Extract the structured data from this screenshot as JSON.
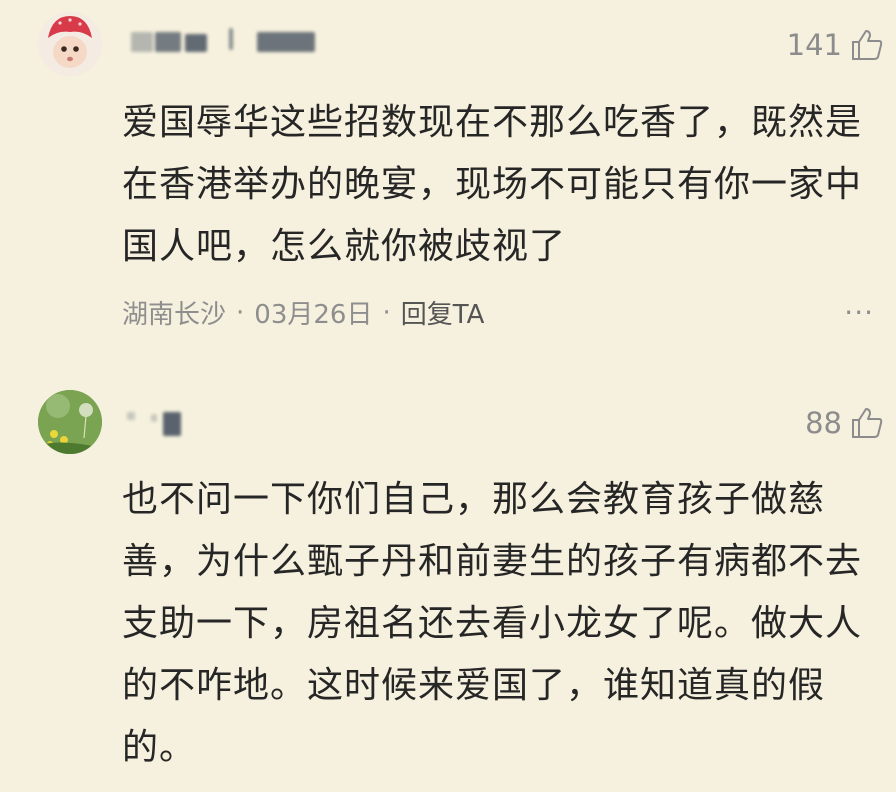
{
  "comments": [
    {
      "likes": "141",
      "text": "爱国辱华这些招数现在不那么吃香了，既然是在香港举办的晚宴，现场不可能只有你一家中国人吧，怎么就你被歧视了",
      "location": "湖南长沙",
      "date": "03月26日",
      "reply_label": "回复TA",
      "separator": "·",
      "more": "···"
    },
    {
      "likes": "88",
      "text": "也不问一下你们自己，那么会教育孩子做慈善，为什么甄子丹和前妻生的孩子有病都不去支助一下，房祖名还去看小龙女了呢。做大人的不咋地。这时候来爱国了，谁知道真的假的。"
    }
  ],
  "icons": {
    "like": "thumbs-up-outline-icon",
    "more": "more-dots-icon"
  },
  "colors": {
    "background": "#f6f1de",
    "text": "#262626",
    "meta": "#8e8e8e"
  }
}
